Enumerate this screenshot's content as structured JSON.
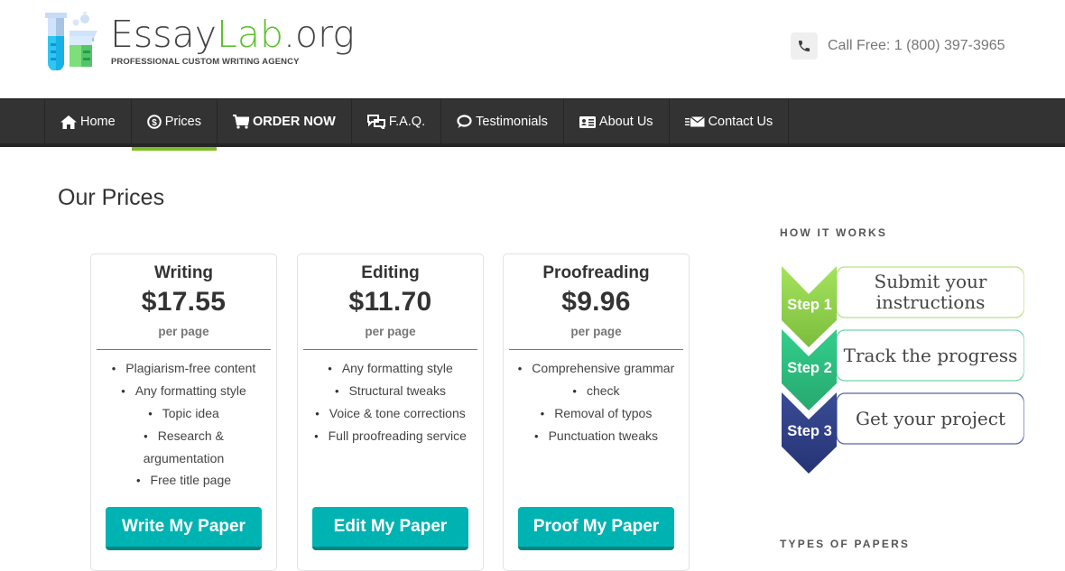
{
  "header": {
    "logo": {
      "name_part1": "Essay",
      "name_part2": "Lab",
      "name_part3": ".org",
      "tagline": "PROFESSIONAL CUSTOM WRITING AGENCY"
    },
    "phone": {
      "icon": "phone-icon",
      "text": "Call Free: 1 (800) 397-3965"
    }
  },
  "nav": {
    "items": [
      {
        "label": "Home",
        "icon": "home-icon",
        "active": false
      },
      {
        "label": "Prices",
        "icon": "dollar-circle-icon",
        "active": true
      },
      {
        "label": "ORDER NOW",
        "icon": "cart-icon",
        "active": false
      },
      {
        "label": "F.A.Q.",
        "icon": "chat-bubbles-icon",
        "active": false
      },
      {
        "label": "Testimonials",
        "icon": "speech-bubble-icon",
        "active": false
      },
      {
        "label": "About Us",
        "icon": "id-card-icon",
        "active": false
      },
      {
        "label": "Contact Us",
        "icon": "envelope-icon",
        "active": false
      }
    ],
    "active_color": "#7dbd27"
  },
  "main": {
    "title": "Our Prices",
    "cards": [
      {
        "title": "Writing",
        "price": "$17.55",
        "unit": "per page",
        "features": [
          "Plagiarism-free content",
          "Any formatting style",
          "Topic idea",
          "Research & argumentation",
          "Free title page"
        ],
        "button": "Write My Paper"
      },
      {
        "title": "Editing",
        "price": "$11.70",
        "unit": "per page",
        "features": [
          "Any formatting style",
          "Structural tweaks",
          "Voice & tone corrections",
          "Full proofreading service"
        ],
        "button": "Edit My Paper"
      },
      {
        "title": "Proofreading",
        "price": "$9.96",
        "unit": "per page",
        "features": [
          "Comprehensive grammar",
          "check",
          "Removal of typos",
          "Punctuation tweaks"
        ],
        "button": "Proof My Paper"
      }
    ],
    "button_color": "#00b3b3"
  },
  "sidebar": {
    "how_it_works": "HOW IT WORKS",
    "steps": [
      {
        "label": "Step 1",
        "text": "Submit your instructions",
        "color": "#8fd14f"
      },
      {
        "label": "Step 2",
        "text": "Track the progress",
        "color": "#2fc089"
      },
      {
        "label": "Step 3",
        "text": "Get your project",
        "color": "#2f3f85"
      }
    ],
    "types_of_papers": "TYPES OF PAPERS"
  }
}
